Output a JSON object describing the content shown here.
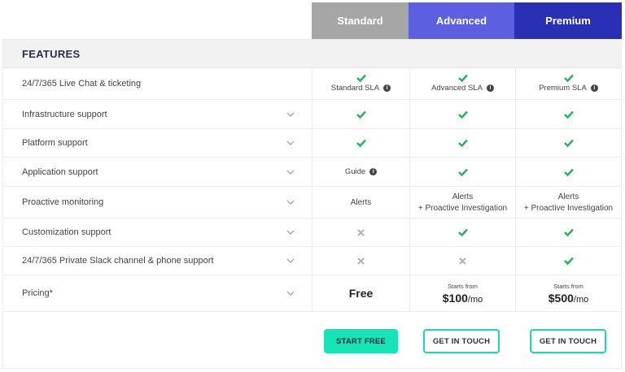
{
  "plans": {
    "standard": "Standard",
    "advanced": "Advanced",
    "premium": "Premium"
  },
  "features_title": "FEATURES",
  "colors": {
    "standard": "#a6a6a6",
    "advanced": "#5b5fe0",
    "premium": "#2a30b4",
    "check": "#22b45a",
    "cta": "#16e3b6"
  },
  "rows": [
    {
      "label": "24/7/365 Live Chat & ticketing",
      "standard": "Standard SLA",
      "advanced": "Advanced SLA",
      "premium": "Premium SLA"
    },
    {
      "label": "Infrastructure support"
    },
    {
      "label": "Platform support"
    },
    {
      "label": "Application support",
      "standard": "Guide"
    },
    {
      "label": "Proactive monitoring",
      "standard": "Alerts",
      "advanced_1": "Alerts",
      "advanced_2": "+ Proactive Investigation",
      "premium_1": "Alerts",
      "premium_2": "+ Proactive Investigation"
    },
    {
      "label": "Customization support"
    },
    {
      "label": "24/7/365 Private Slack channel & phone support"
    },
    {
      "label": "Pricing*",
      "standard": "Free",
      "starts": "Starts from",
      "advanced_price": "$100",
      "premium_price": "$500",
      "unit": "/mo"
    }
  ],
  "info_glyph": "i",
  "buttons": {
    "start_free": "START FREE",
    "get_in_touch": "GET IN TOUCH"
  }
}
